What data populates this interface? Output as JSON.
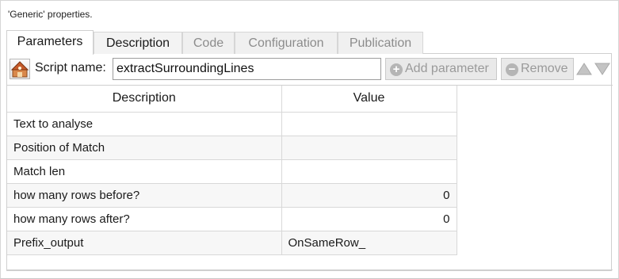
{
  "window": {
    "title": "'Generic' properties."
  },
  "tabs": [
    {
      "label": "Parameters",
      "state": "active"
    },
    {
      "label": "Description",
      "state": "normal"
    },
    {
      "label": "Code",
      "state": "disabled"
    },
    {
      "label": "Configuration",
      "state": "disabled"
    },
    {
      "label": "Publication",
      "state": "disabled"
    }
  ],
  "toolbar": {
    "script_icon": "script-icon",
    "script_label": "Script name:",
    "script_value": "extractSurroundingLines",
    "add_label": "Add parameter",
    "add_icon": "plus-circle-icon",
    "remove_label": "Remove",
    "remove_icon": "minus-circle-icon",
    "move_up_icon": "arrow-up-icon",
    "move_down_icon": "arrow-down-icon"
  },
  "table": {
    "headers": [
      "Description",
      "Value"
    ],
    "rows": [
      {
        "description": "Text to analyse",
        "value": ""
      },
      {
        "description": "Position of Match",
        "value": ""
      },
      {
        "description": "Match len",
        "value": ""
      },
      {
        "description": "how many rows before?",
        "value": "0"
      },
      {
        "description": "how many rows after?",
        "value": "0"
      },
      {
        "description": "Prefix_output",
        "value": "OnSameRow_"
      }
    ]
  },
  "colors": {
    "disabled_text": "#9a9a9a",
    "grid_line": "#d8d8d8",
    "alt_row": "#f7f7f7"
  }
}
